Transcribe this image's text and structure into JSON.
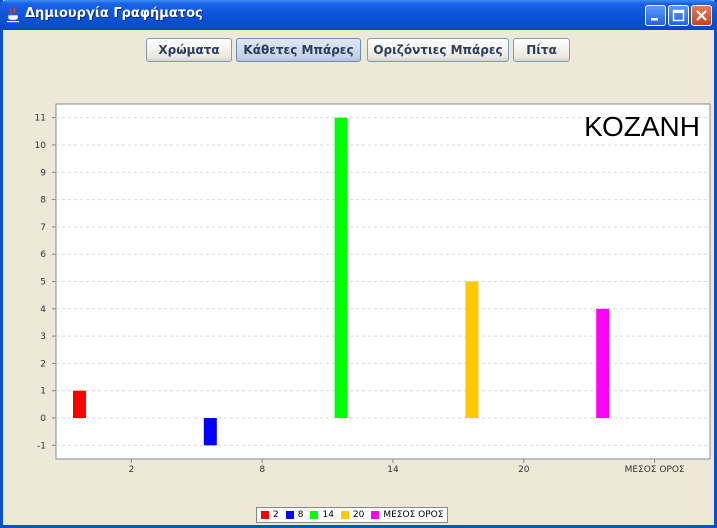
{
  "window": {
    "title": "Δημιουργία Γραφήματος"
  },
  "toolbar": {
    "buttons": [
      {
        "label": "Χρώματα",
        "active": false
      },
      {
        "label": "Κάθετες Μπάρες",
        "active": true
      },
      {
        "label": "Οριζόντιες Μπάρες",
        "active": false
      },
      {
        "label": "Πίτα",
        "active": false
      }
    ]
  },
  "chart_data": {
    "type": "bar",
    "title": "ΚΟΖΑΝΗ",
    "categories": [
      "2",
      "8",
      "14",
      "20",
      "ΜΕΣΟΣ ΟΡΟΣ"
    ],
    "values": [
      1,
      -1,
      11,
      5,
      4
    ],
    "colors": [
      "#ff0000",
      "#0000ff",
      "#00ff00",
      "#ffc800",
      "#ff00ff"
    ],
    "ylim": [
      -1.5,
      11.5
    ],
    "yticks": [
      -1,
      0,
      1,
      2,
      3,
      4,
      5,
      6,
      7,
      8,
      9,
      10,
      11
    ],
    "grid": true,
    "legend": {
      "placement": "bottom",
      "entries": [
        "2",
        "8",
        "14",
        "20",
        "ΜΕΣΟΣ ΟΡΟΣ"
      ]
    }
  }
}
